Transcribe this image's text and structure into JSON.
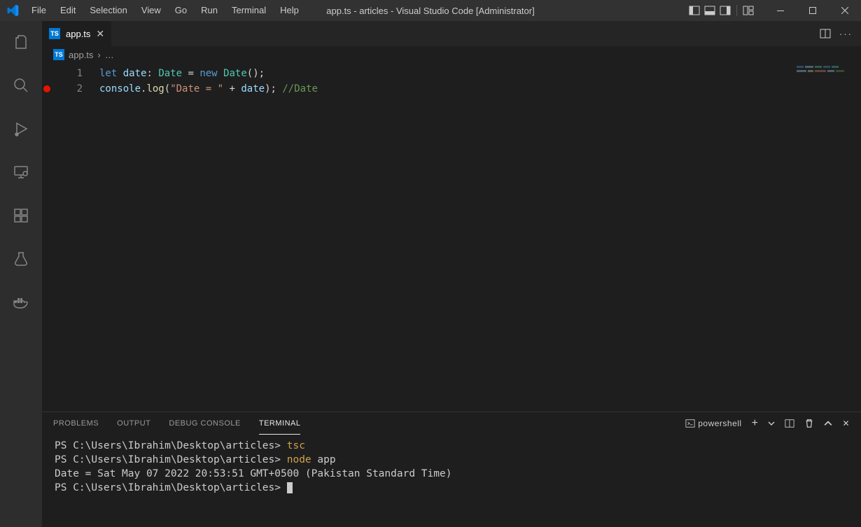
{
  "title": "app.ts - articles - Visual Studio Code [Administrator]",
  "menu": [
    "File",
    "Edit",
    "Selection",
    "View",
    "Go",
    "Run",
    "Terminal",
    "Help"
  ],
  "tab": {
    "filename": "app.ts"
  },
  "breadcrumbs": {
    "filename": "app.ts",
    "more": "…"
  },
  "code": {
    "lines": [
      {
        "num": "1",
        "bp": false,
        "tokens": [
          {
            "cls": "tok-kw",
            "text": "let"
          },
          {
            "cls": "tok-plain",
            "text": " "
          },
          {
            "cls": "tok-var",
            "text": "date"
          },
          {
            "cls": "tok-plain",
            "text": ": "
          },
          {
            "cls": "tok-type",
            "text": "Date"
          },
          {
            "cls": "tok-plain",
            "text": " = "
          },
          {
            "cls": "tok-kw",
            "text": "new"
          },
          {
            "cls": "tok-plain",
            "text": " "
          },
          {
            "cls": "tok-type",
            "text": "Date"
          },
          {
            "cls": "tok-plain",
            "text": "();"
          }
        ]
      },
      {
        "num": "2",
        "bp": true,
        "tokens": [
          {
            "cls": "tok-obj",
            "text": "console"
          },
          {
            "cls": "tok-plain",
            "text": "."
          },
          {
            "cls": "tok-fn",
            "text": "log"
          },
          {
            "cls": "tok-plain",
            "text": "("
          },
          {
            "cls": "tok-str",
            "text": "\"Date = \""
          },
          {
            "cls": "tok-plain",
            "text": " + "
          },
          {
            "cls": "tok-var",
            "text": "date"
          },
          {
            "cls": "tok-plain",
            "text": "); "
          },
          {
            "cls": "tok-comment",
            "text": "//Date"
          }
        ]
      }
    ]
  },
  "panel": {
    "tabs": [
      "PROBLEMS",
      "OUTPUT",
      "DEBUG CONSOLE",
      "TERMINAL"
    ],
    "active": "TERMINAL",
    "terminal_label": "powershell"
  },
  "terminal": {
    "lines": [
      {
        "segs": [
          {
            "cls": "term-white",
            "text": "PS C:\\Users\\Ibrahim\\Desktop\\articles> "
          },
          {
            "cls": "term-yellow",
            "text": "tsc"
          }
        ]
      },
      {
        "segs": [
          {
            "cls": "term-white",
            "text": "PS C:\\Users\\Ibrahim\\Desktop\\articles> "
          },
          {
            "cls": "term-yellow",
            "text": "node "
          },
          {
            "cls": "term-white",
            "text": "app"
          }
        ]
      },
      {
        "segs": [
          {
            "cls": "term-white",
            "text": "Date = Sat May 07 2022 20:53:51 GMT+0500 (Pakistan Standard Time)"
          }
        ]
      },
      {
        "segs": [
          {
            "cls": "term-white",
            "text": "PS C:\\Users\\Ibrahim\\Desktop\\articles> "
          }
        ],
        "cursor": true
      }
    ]
  }
}
